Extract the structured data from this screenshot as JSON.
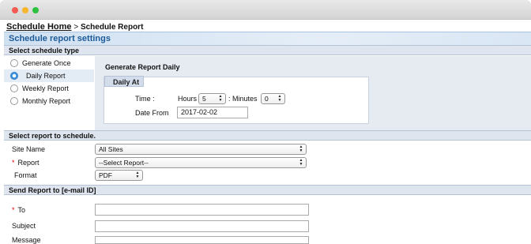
{
  "window": {
    "controls": [
      "close",
      "minimize",
      "maximize"
    ]
  },
  "breadcrumb": {
    "home": "Schedule Home",
    "separator": ">",
    "current": "Schedule Report"
  },
  "page": {
    "title": "Schedule report settings"
  },
  "schedule_type": {
    "section_title": "Select schedule type",
    "options": [
      {
        "label": "Generate Once",
        "selected": false
      },
      {
        "label": "Daily Report",
        "selected": true
      },
      {
        "label": "Weekly Report",
        "selected": false
      },
      {
        "label": "Monthly Report",
        "selected": false
      }
    ]
  },
  "daily": {
    "heading": "Generate Report Daily",
    "box_title": "Daily At",
    "time_label": "Time :",
    "hours_label": "Hours",
    "hours_value": "5",
    "minutes_label": ": Minutes",
    "minutes_value": "0",
    "date_from_label": "Date From",
    "date_from_value": "2017-02-02"
  },
  "report": {
    "section_title": "Select report to schedule.",
    "site_name_label": "Site Name",
    "site_name_value": "All Sites",
    "report_label": "Report",
    "report_value": "--Select Report--",
    "format_label": "Format",
    "format_value": "PDF",
    "required_mark": "*"
  },
  "email": {
    "section_title": "Send Report to [e-mail ID]",
    "to_label": "To",
    "subject_label": "Subject",
    "message_label": "Message",
    "to_value": "",
    "subject_value": "",
    "message_value": ""
  }
}
